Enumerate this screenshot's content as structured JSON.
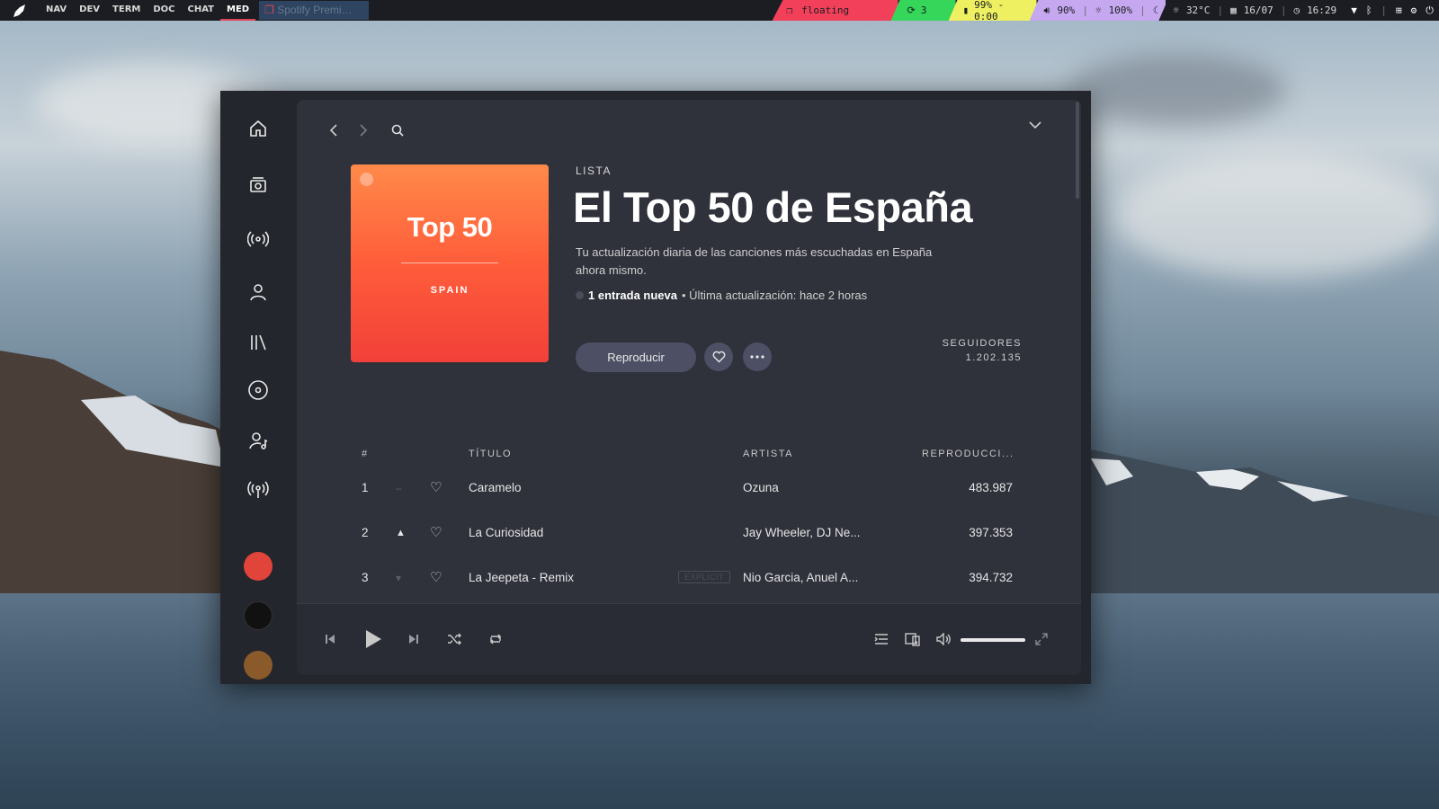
{
  "topbar": {
    "workspaces": [
      "NAV",
      "DEV",
      "TERM",
      "DOC",
      "CHAT",
      "MED"
    ],
    "active_workspace": "MED",
    "window_title": "Spotify Premi…",
    "status": {
      "layout_mode": "floating",
      "updates": "3",
      "battery": "99% - 0:00",
      "volume": "90%",
      "brightness": "100%",
      "temperature": "32°C",
      "date": "16/07",
      "time": "16:29"
    }
  },
  "sidebar": {
    "items": [
      "home-icon",
      "browse-icon",
      "radio-icon",
      "profile-icon",
      "library-icon",
      "disc-icon",
      "artist-icon",
      "podcast-icon"
    ]
  },
  "playlist": {
    "cover_title": "Top 50",
    "cover_subtitle": "SPAIN",
    "kicker": "LISTA",
    "title": "El Top 50 de España",
    "description": "Tu actualización diaria de las canciones más escuchadas en España ahora mismo.",
    "new_entries": "1 entrada nueva",
    "last_update": "• Última actualización: hace 2 horas",
    "play_label": "Reproducir",
    "followers_label": "SEGUIDORES",
    "followers_count": "1.202.135"
  },
  "table": {
    "headers": {
      "num": "#",
      "title": "TÍTULO",
      "artist": "ARTISTA",
      "plays": "REPRODUCCI..."
    },
    "rows": [
      {
        "num": "1",
        "trend": "same",
        "title": "Caramelo",
        "explicit": "",
        "artist": "Ozuna",
        "plays": "483.987"
      },
      {
        "num": "2",
        "trend": "up",
        "title": "La Curiosidad",
        "explicit": "",
        "artist": "Jay Wheeler, DJ Ne...",
        "plays": "397.353"
      },
      {
        "num": "3",
        "trend": "down",
        "title": "La Jeepeta - Remix",
        "explicit": "EXPLICIT",
        "artist": "Nio Garcia, Anuel A...",
        "plays": "394.732"
      }
    ]
  },
  "player": {
    "volume_fraction": 1.0
  },
  "colors": {
    "accent_cover": "#ff5d3a",
    "window_bg": "#24262d",
    "panel_bg": "#2f313b",
    "floating_segment": "#f2405a",
    "updates_segment": "#35d65a",
    "battery_segment": "#eef062",
    "sysinfo_segment": "#c6a8f0"
  }
}
